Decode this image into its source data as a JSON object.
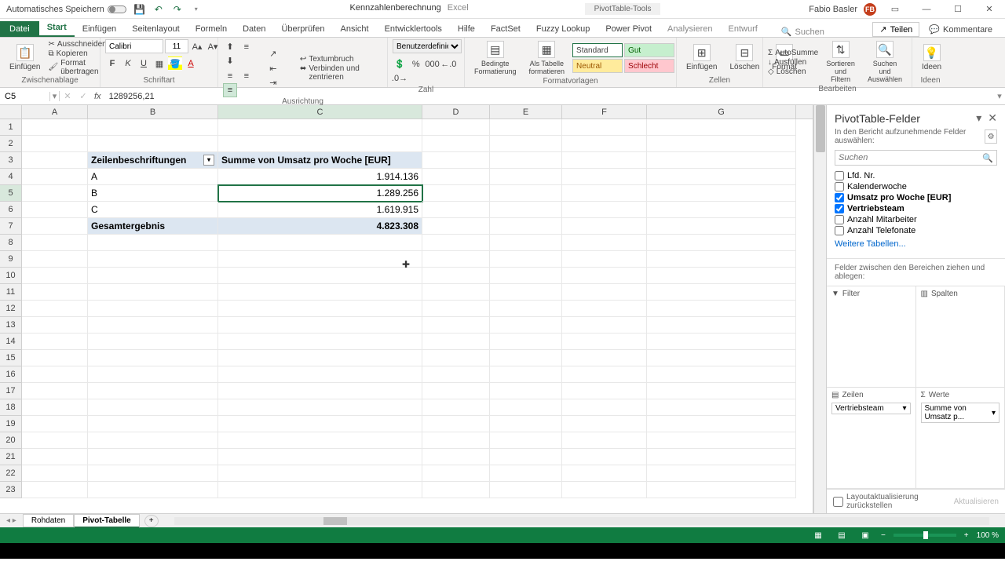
{
  "titlebar": {
    "autosave": "Automatisches Speichern",
    "docname": "Kennzahlenberechnung",
    "appname": "Excel",
    "tool": "PivotTable-Tools",
    "user": "Fabio Basler",
    "user_initials": "FB"
  },
  "tabs": {
    "file": "Datei",
    "start": "Start",
    "einfuegen": "Einfügen",
    "seitenlayout": "Seitenlayout",
    "formeln": "Formeln",
    "daten": "Daten",
    "ueberpruefen": "Überprüfen",
    "ansicht": "Ansicht",
    "entwickler": "Entwicklertools",
    "hilfe": "Hilfe",
    "factset": "FactSet",
    "fuzzy": "Fuzzy Lookup",
    "powerpivot": "Power Pivot",
    "analysieren": "Analysieren",
    "entwurf": "Entwurf",
    "suchen": "Suchen",
    "teilen": "Teilen",
    "kommentare": "Kommentare"
  },
  "ribbon": {
    "einfuegen": "Einfügen",
    "ausschneiden": "Ausschneiden",
    "kopieren": "Kopieren",
    "format_uebertragen": "Format übertragen",
    "zwischenablage": "Zwischenablage",
    "font_name": "Calibri",
    "font_size": "11",
    "schriftart": "Schriftart",
    "textumbruch": "Textumbruch",
    "verbinden": "Verbinden und zentrieren",
    "ausrichtung": "Ausrichtung",
    "zahlformat": "Benutzerdefinier",
    "zahl": "Zahl",
    "bedingte": "Bedingte Formatierung",
    "als_tabelle": "Als Tabelle formatieren",
    "standard": "Standard",
    "gut": "Gut",
    "neutral": "Neutral",
    "schlecht": "Schlecht",
    "formatvorlagen": "Formatvorlagen",
    "einfg": "Einfügen",
    "loeschen": "Löschen",
    "format": "Format",
    "zellen": "Zellen",
    "autosumme": "AutoSumme",
    "ausfuellen": "Ausfüllen",
    "loeschen2": "Löschen",
    "sortieren": "Sortieren und Filtern",
    "suchen": "Suchen und Auswählen",
    "bearbeiten": "Bearbeiten",
    "ideen": "Ideen"
  },
  "formula": {
    "cell_ref": "C5",
    "value": "1289256,21"
  },
  "columns": [
    "A",
    "B",
    "C",
    "D",
    "E",
    "F",
    "G"
  ],
  "pivot": {
    "row_header": "Zeilenbeschriftungen",
    "val_header": "Summe von Umsatz pro Woche [EUR]",
    "rows": [
      {
        "label": "A",
        "value": "1.914.136"
      },
      {
        "label": "B",
        "value": "1.289.256"
      },
      {
        "label": "C",
        "value": "1.619.915"
      }
    ],
    "total_label": "Gesamtergebnis",
    "total_value": "4.823.308"
  },
  "pane": {
    "title": "PivotTable-Felder",
    "subtitle": "In den Bericht aufzunehmende Felder auswählen:",
    "search": "Suchen",
    "fields": [
      {
        "name": "Lfd. Nr.",
        "checked": false
      },
      {
        "name": "Kalenderwoche",
        "checked": false
      },
      {
        "name": "Umsatz pro Woche [EUR]",
        "checked": true
      },
      {
        "name": "Vertriebsteam",
        "checked": true
      },
      {
        "name": "Anzahl Mitarbeiter",
        "checked": false
      },
      {
        "name": "Anzahl Telefonate",
        "checked": false
      }
    ],
    "more": "Weitere Tabellen...",
    "areas_label": "Felder zwischen den Bereichen ziehen und ablegen:",
    "filter": "Filter",
    "columns": "Spalten",
    "rows_area": "Zeilen",
    "values": "Werte",
    "row_chip": "Vertriebsteam",
    "val_chip": "Summe von Umsatz p...",
    "defer": "Layoutaktualisierung zurückstellen",
    "update": "Aktualisieren"
  },
  "sheets": {
    "rohdaten": "Rohdaten",
    "pivot": "Pivot-Tabelle"
  },
  "status": {
    "zoom": "100 %"
  }
}
